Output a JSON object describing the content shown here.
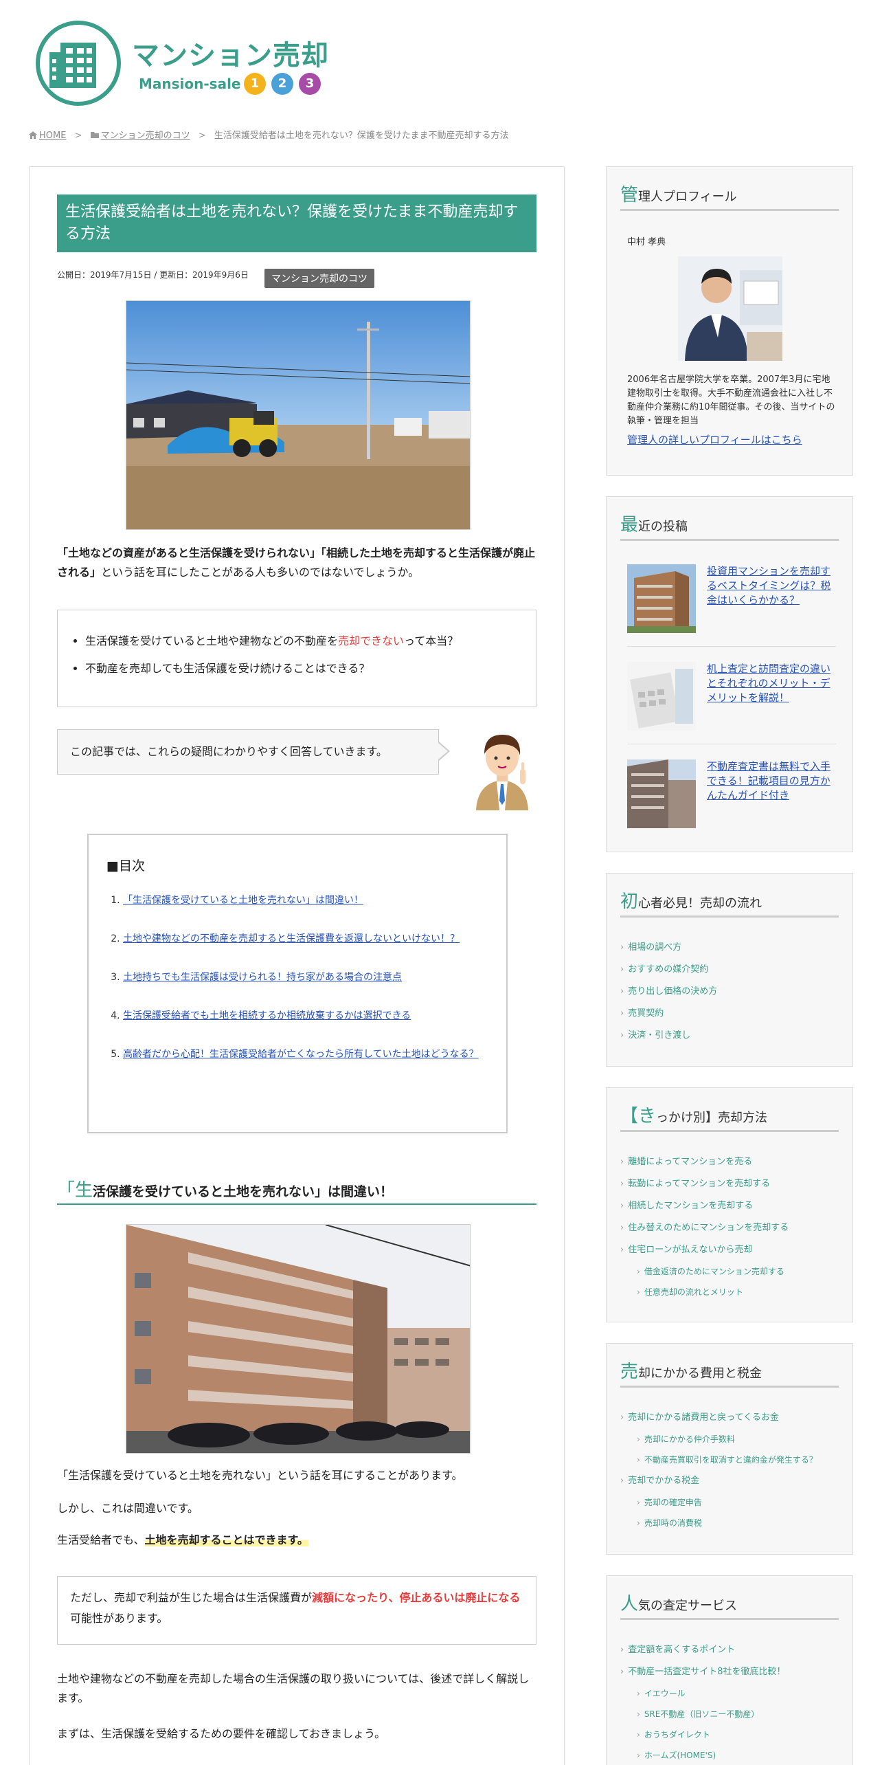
{
  "header": {
    "logo_title": "マンション売却",
    "logo_sub": "Mansion-sale",
    "logo_nums": [
      "1",
      "2",
      "3"
    ],
    "num_colors": [
      "#f5b31b",
      "#4aa1d8",
      "#a64ca6"
    ],
    "brand_color": "#3a9e8b"
  },
  "breadcrumb": {
    "home": "HOME",
    "category": "マンション売却のコツ",
    "current": "生活保護受給者は土地を売れない？保護を受けたまま不動産売却する方法"
  },
  "article": {
    "title": "生活保護受給者は土地を売れない？保護を受けたまま不動産売却する方法",
    "meta": "公開日：2019年7月15日 / 更新日：2019年9月6日",
    "category": "マンション売却のコツ",
    "intro": {
      "q1": "「土地などの資産があると生活保護を受けられない」",
      "q2": "「相続した土地を売却すると生活保護が廃止される」",
      "rest": "という話を耳にしたことがある人も多いのではないでしょうか。"
    },
    "questions": [
      {
        "before": "生活保護を受けていると土地や建物などの不動産を",
        "red": "売却できない",
        "after": "って本当？"
      },
      {
        "before": "不動産を売却しても生活保護を受け続けることはできる？",
        "red": "",
        "after": ""
      }
    ],
    "speech": "この記事では、これらの疑問にわかりやすく回答していきます。",
    "toc": {
      "title": "■目次",
      "items": [
        "「生活保護を受けていると土地を売れない」は間違い！",
        "土地や建物などの不動産を売却すると生活保護費を返還しないといけない！？",
        "土地持ちでも生活保護は受けられる！持ち家がある場合の注意点",
        "生活保護受給者でも土地を相続するか相続放棄するかは選択できる",
        "高齢者だから心配！生活保護受給者が亡くなったら所有していた土地はどうなる？"
      ]
    },
    "h2": {
      "first": "「生",
      "rest": "活保護を受けていると土地を売れない」は間違い！"
    },
    "p1": "「生活保護を受けていると土地を売れない」という話を耳にすることがあります。",
    "p2": "しかし、これは間違いです。",
    "p3": {
      "before": "生活受給者でも、",
      "hl": "土地を売却することはできます。"
    },
    "warn": {
      "before": "ただし、売却で利益が生じた場合は生活保護費が",
      "red": "減額になったり、停止あるいは廃止になる",
      "after": "可能性があります。"
    },
    "p4": "土地や建物などの不動産を売却した場合の生活保護の取り扱いについては、後述で詳しく解説します。",
    "p5": "まずは、生活保護を受給するための要件を確認しておきましょう。"
  },
  "sidebar": {
    "profile": {
      "title_first": "管",
      "title_rest": "理人プロフィール",
      "name": "中村 孝典",
      "text": "2006年名古屋学院大学を卒業。2007年3月に宅地建物取引士を取得。大手不動産流通会社に入社し不動産仲介業務に約10年間従事。その後、当サイトの執筆・管理を担当",
      "link": "管理人の詳しいプロフィールはこちら"
    },
    "recent": {
      "title_first": "最",
      "title_rest": "近の投稿",
      "posts": [
        "投資用マンションを売却するベストタイミングは？税金はいくらかかる？",
        "机上査定と訪問査定の違いとそれぞれのメリット・デメリットを解説！",
        "不動産査定書は無料で入手できる！記載項目の見方かんたんガイド付き"
      ]
    },
    "flow": {
      "title_first": "初",
      "title_rest": "心者必見！売却の流れ",
      "items": [
        "相場の調べ方",
        "おすすめの媒介契約",
        "売り出し価格の決め方",
        "売買契約",
        "決済・引き渡し"
      ]
    },
    "reason": {
      "title_first": "【き",
      "title_rest": "っかけ別】売却方法",
      "items": [
        "離婚によってマンションを売る",
        "転勤によってマンションを売却する",
        "相続したマンションを売却する",
        "住み替えのためにマンションを売却する",
        "住宅ローンが払えないから売却"
      ],
      "subs": [
        "借金返済のためにマンション売却する",
        "任意売却の流れとメリット"
      ]
    },
    "cost": {
      "title_first": "売",
      "title_rest": "却にかかる費用と税金",
      "item1": "売却にかかる諸費用と戻ってくるお金",
      "subs1": [
        "売却にかかる仲介手数料",
        "不動産売買取引を取消すと違約金が発生する？"
      ],
      "item2": "売却でかかる税金",
      "subs2": [
        "売却の確定申告",
        "売却時の消費税"
      ]
    },
    "assess": {
      "title_first": "人",
      "title_rest": "気の査定サービス",
      "items": [
        "査定額を高くするポイント",
        "不動産一括査定サイト8社を徹底比較！"
      ],
      "subs": [
        "イエウール",
        "SRE不動産（旧ソニー不動産）",
        "おうちダイレクト",
        "ホームズ(HOME'S)"
      ]
    }
  }
}
